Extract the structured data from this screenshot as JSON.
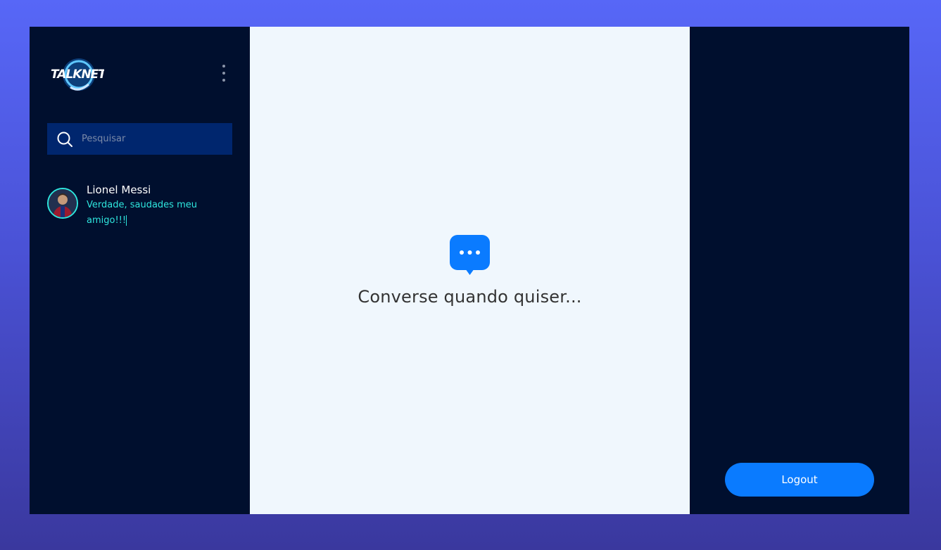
{
  "app": {
    "logo_text": "TALKNET"
  },
  "sidebar": {
    "search": {
      "placeholder": "Pesquisar",
      "icon": "search-icon"
    },
    "menu_icon": "kebab-menu-icon",
    "contacts": [
      {
        "name": "Lionel Messi",
        "last_message": "Verdade, saudades meu amigo!!!"
      }
    ]
  },
  "main": {
    "empty_icon": "chat-bubble-icon",
    "empty_text": "Converse quando quiser..."
  },
  "right_panel": {
    "logout_label": "Logout"
  },
  "colors": {
    "page_gradient_top": "#5767f7",
    "page_gradient_bottom": "#3a389e",
    "panel_dark": "#000f2e",
    "search_bg": "#00266e",
    "main_bg": "#f0f7fd",
    "accent_blue": "#0a7bff",
    "accent_cyan": "#2ee6de"
  }
}
